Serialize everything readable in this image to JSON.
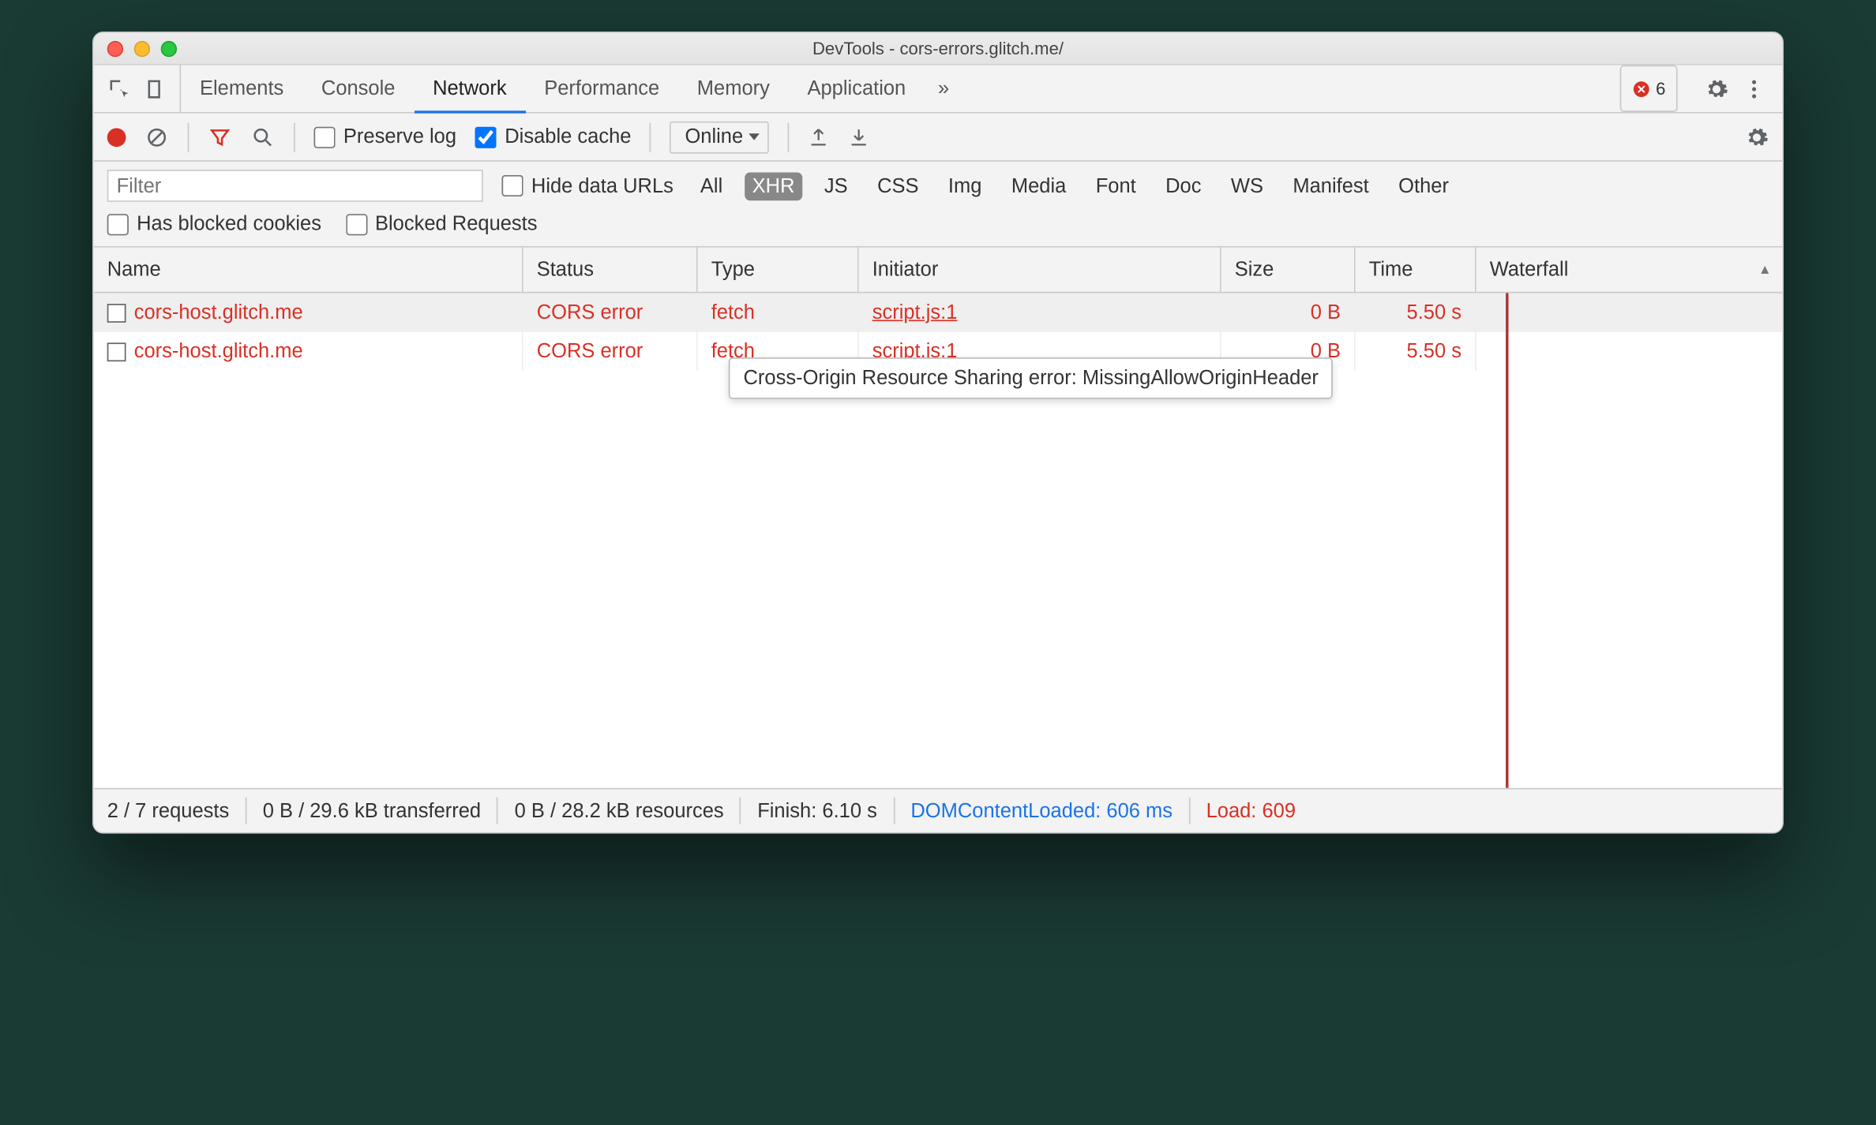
{
  "window_title": "DevTools - cors-errors.glitch.me/",
  "tabs": {
    "items": [
      "Elements",
      "Console",
      "Network",
      "Performance",
      "Memory",
      "Application"
    ],
    "overflow_glyph": "»",
    "active_index": 2
  },
  "errors": {
    "count": "6"
  },
  "toolbar": {
    "preserve_log": "Preserve log",
    "disable_cache": "Disable cache",
    "disable_cache_checked": true,
    "throttling": "Online"
  },
  "filterbar": {
    "filter_placeholder": "Filter",
    "hide_data_urls": "Hide data URLs",
    "types": [
      "All",
      "XHR",
      "JS",
      "CSS",
      "Img",
      "Media",
      "Font",
      "Doc",
      "WS",
      "Manifest",
      "Other"
    ],
    "selected_type_index": 1,
    "has_blocked_cookies": "Has blocked cookies",
    "blocked_requests": "Blocked Requests"
  },
  "columns": {
    "name": "Name",
    "status": "Status",
    "type": "Type",
    "initiator": "Initiator",
    "size": "Size",
    "time": "Time",
    "waterfall": "Waterfall"
  },
  "rows": [
    {
      "name": "cors-host.glitch.me",
      "status": "CORS error",
      "type": "fetch",
      "initiator": "script.js:1",
      "size": "0 B",
      "time": "5.50 s",
      "selected": true
    },
    {
      "name": "cors-host.glitch.me",
      "status": "CORS error",
      "type": "fetch",
      "initiator": "script.js:1",
      "size": "0 B",
      "time": "5.50 s",
      "selected": false
    }
  ],
  "tooltip": "Cross-Origin Resource Sharing error: MissingAllowOriginHeader",
  "status": {
    "requests": "2 / 7 requests",
    "transferred": "0 B / 29.6 kB transferred",
    "resources": "0 B / 28.2 kB resources",
    "finish": "Finish: 6.10 s",
    "dcl": "DOMContentLoaded: 606 ms",
    "load": "Load: 609"
  }
}
